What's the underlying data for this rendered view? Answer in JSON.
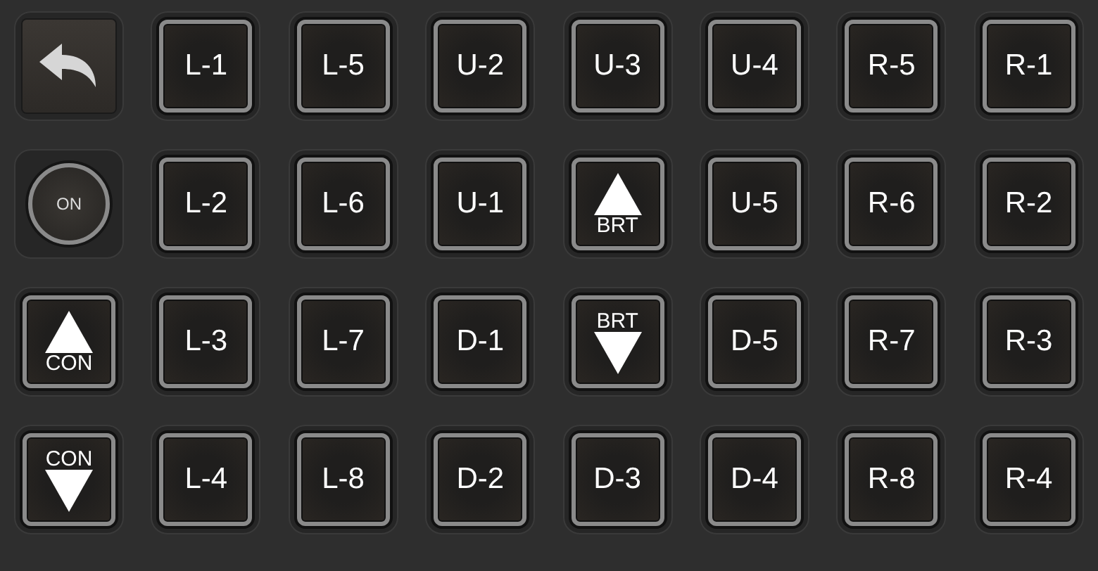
{
  "keys": [
    {
      "kind": "back"
    },
    {
      "kind": "text",
      "label": "L-1"
    },
    {
      "kind": "text",
      "label": "L-5"
    },
    {
      "kind": "text",
      "label": "U-2"
    },
    {
      "kind": "text",
      "label": "U-3"
    },
    {
      "kind": "text",
      "label": "U-4"
    },
    {
      "kind": "text",
      "label": "R-5"
    },
    {
      "kind": "text",
      "label": "R-1"
    },
    {
      "kind": "power",
      "label": "ON"
    },
    {
      "kind": "text",
      "label": "L-2"
    },
    {
      "kind": "text",
      "label": "L-6"
    },
    {
      "kind": "text",
      "label": "U-1"
    },
    {
      "kind": "up",
      "label": "BRT"
    },
    {
      "kind": "text",
      "label": "U-5"
    },
    {
      "kind": "text",
      "label": "R-6"
    },
    {
      "kind": "text",
      "label": "R-2"
    },
    {
      "kind": "up",
      "label": "CON"
    },
    {
      "kind": "text",
      "label": "L-3"
    },
    {
      "kind": "text",
      "label": "L-7"
    },
    {
      "kind": "text",
      "label": "D-1"
    },
    {
      "kind": "down",
      "label": "BRT"
    },
    {
      "kind": "text",
      "label": "D-5"
    },
    {
      "kind": "text",
      "label": "R-7"
    },
    {
      "kind": "text",
      "label": "R-3"
    },
    {
      "kind": "down",
      "label": "CON"
    },
    {
      "kind": "text",
      "label": "L-4"
    },
    {
      "kind": "text",
      "label": "L-8"
    },
    {
      "kind": "text",
      "label": "D-2"
    },
    {
      "kind": "text",
      "label": "D-3"
    },
    {
      "kind": "text",
      "label": "D-4"
    },
    {
      "kind": "text",
      "label": "R-8"
    },
    {
      "kind": "text",
      "label": "R-4"
    }
  ]
}
